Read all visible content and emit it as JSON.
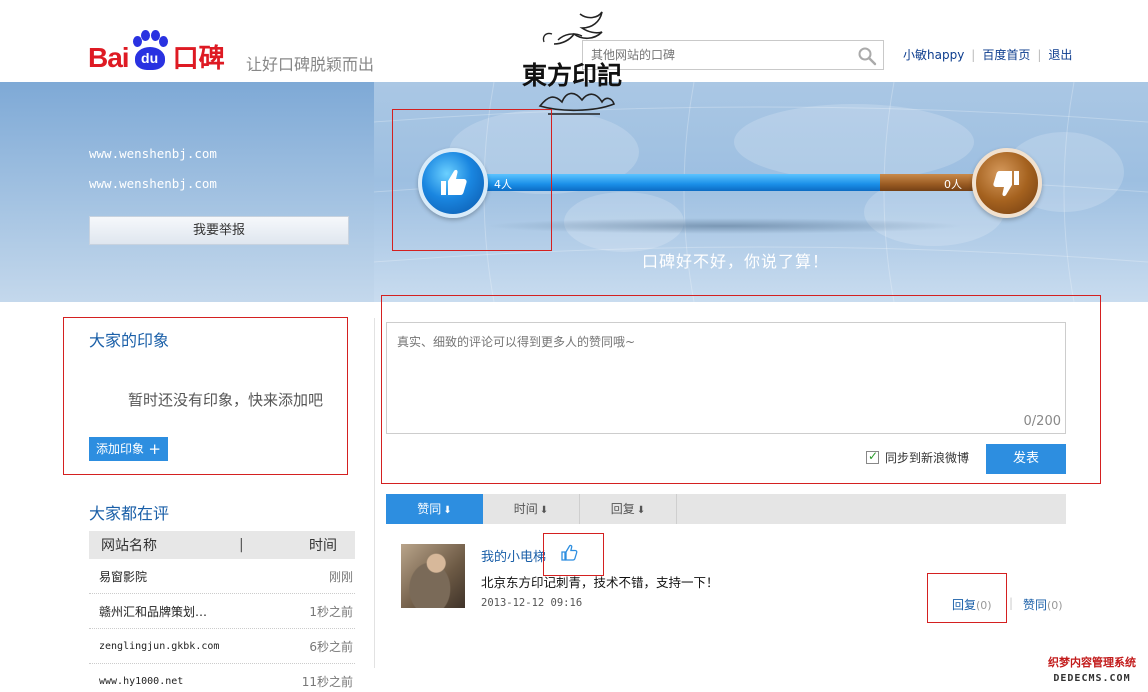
{
  "header": {
    "logo_bai": "Bai",
    "logo_du": "du",
    "logo_koubei": "口碑",
    "slogan": "让好口碑脱颖而出",
    "search_placeholder": "其他网站的口碑",
    "user_name": "小敏happy",
    "home_link": "百度首页",
    "logout_link": "退出"
  },
  "seal": {
    "text": "東方印記"
  },
  "banner": {
    "url_line_1": "www.wenshenbj.com",
    "url_line_2": "www.wenshenbj.com",
    "report_button": "我要举报",
    "like_count": "4人",
    "dislike_count": "0人",
    "caption": "口碑好不好，你说了算！"
  },
  "impressions": {
    "title": "大家的印象",
    "empty_text": "暂时还没有印象，快来添加吧",
    "add_button": "添加印象"
  },
  "rating_list": {
    "title": "大家都在评",
    "col_site": "网站名称",
    "col_sep": "|",
    "col_time": "时间",
    "rows": [
      {
        "site": "易窗影院",
        "time": "刚刚"
      },
      {
        "site": "赣州汇和品牌策划…",
        "time": "1秒之前"
      },
      {
        "site": "zenglingjun.gkbk.com",
        "time": "6秒之前"
      },
      {
        "site": "www.hy1000.net",
        "time": "11秒之前"
      }
    ]
  },
  "comment_form": {
    "placeholder": "真实、细致的评论可以得到更多人的赞同哦~",
    "counter": "0/200",
    "sync_label": "同步到新浪微博",
    "sync_checked": true,
    "publish_button": "发表"
  },
  "sort_tabs": [
    {
      "label": "赞同",
      "active": true
    },
    {
      "label": "时间",
      "active": false
    },
    {
      "label": "回复",
      "active": false
    }
  ],
  "comment": {
    "name": "我的小电梯",
    "text": "北京东方印记刺青，技术不错，支持一下！",
    "time": "2013-12-12 09:16",
    "reply_label": "回复",
    "reply_count": "(0)",
    "agree_label": "赞同",
    "agree_count": "(0)",
    "action_sep": "|"
  },
  "corner_watermark": {
    "line1": "织梦内容管理系统",
    "line2": "DEDECMS.COM"
  },
  "colors": {
    "brand_red": "#de1a23",
    "brand_blue": "#2932e1",
    "accent_blue": "#2d8ee0",
    "highlight_red": "#d42020"
  }
}
